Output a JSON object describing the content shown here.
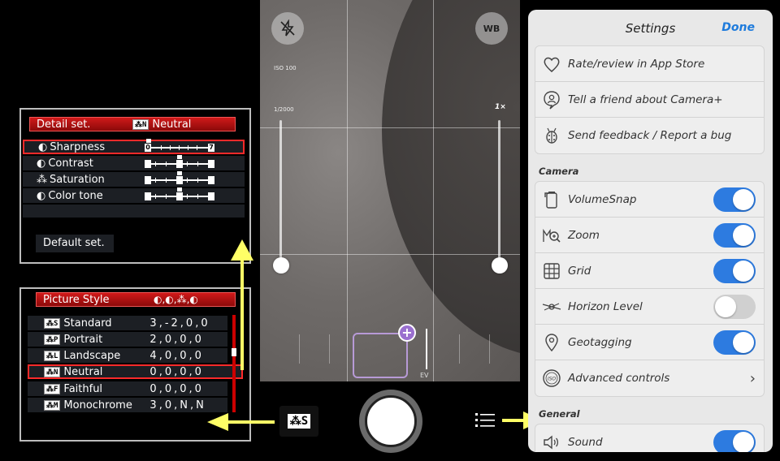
{
  "viewfinder": {
    "flash_icon": "flash-off-icon",
    "wb_label": "WB",
    "iso_label": "ISO 100",
    "shutter_label": "1/2000",
    "zoom_label": "1×",
    "ev_label": "EV"
  },
  "canon_detail": {
    "header_title": "Detail set.",
    "header_style_tag": "⁂N",
    "header_style_name": "Neutral",
    "rows": [
      {
        "label": "Sharpness",
        "icon": "sharpness-icon",
        "scale_left": "0",
        "scale_right": "7",
        "selected": true
      },
      {
        "label": "Contrast",
        "icon": "contrast-icon",
        "scale_left": "",
        "scale_right": "",
        "selected": false
      },
      {
        "label": "Saturation",
        "icon": "saturation-icon",
        "scale_left": "",
        "scale_right": "",
        "selected": false
      },
      {
        "label": "Color tone",
        "icon": "color-tone-icon",
        "scale_left": "",
        "scale_right": "",
        "selected": false
      }
    ],
    "default_button": "Default set."
  },
  "canon_picture_style": {
    "header_title": "Picture Style",
    "header_icons": "◐,◐,⁂,◐",
    "rows": [
      {
        "tag": "⁂S",
        "name": "Standard",
        "values": "3,-2,0,0",
        "selected": false
      },
      {
        "tag": "⁂P",
        "name": "Portrait",
        "values": "2,0,0,0",
        "selected": false
      },
      {
        "tag": "⁂L",
        "name": "Landscape",
        "values": "4,0,0,0",
        "selected": false
      },
      {
        "tag": "⁂N",
        "name": "Neutral",
        "values": "0,0,0,0",
        "selected": true
      },
      {
        "tag": "⁂F",
        "name": "Faithful",
        "values": "0,0,0,0",
        "selected": false
      },
      {
        "tag": "⁂M",
        "name": "Monochrome",
        "values": "3,0,N,N",
        "selected": false
      }
    ]
  },
  "bottom_bar": {
    "picture_style_button": "⁂S",
    "shutter_icon": "shutter-button-icon",
    "menu_icon": "hamburger-menu-icon"
  },
  "settings": {
    "title": "Settings",
    "done_label": "Done",
    "top_items": [
      {
        "label": "Rate/review in App Store",
        "icon": "heart-icon"
      },
      {
        "label": "Tell a friend about Camera+",
        "icon": "person-bubble-icon"
      },
      {
        "label": "Send feedback / Report a bug",
        "icon": "ladybug-icon"
      }
    ],
    "camera_section": "Camera",
    "camera_items": [
      {
        "label": "VolumeSnap",
        "icon": "phone-volume-icon",
        "toggle": true
      },
      {
        "label": "Zoom",
        "icon": "zoom-icon",
        "toggle": true
      },
      {
        "label": "Grid",
        "icon": "grid-icon",
        "toggle": true
      },
      {
        "label": "Horizon Level",
        "icon": "horizon-level-icon",
        "toggle": false
      },
      {
        "label": "Geotagging",
        "icon": "location-pin-icon",
        "toggle": true
      },
      {
        "label": "Advanced controls",
        "icon": "iso-icon",
        "toggle": null
      }
    ],
    "general_section": "General",
    "general_items": [
      {
        "label": "Sound",
        "icon": "speaker-icon",
        "toggle": true
      }
    ]
  },
  "colors": {
    "toggle_on": "#2d7be0",
    "done_blue": "#1e7bdc",
    "canon_red": "#d01a1a",
    "arrow_yellow": "#ffff66"
  }
}
